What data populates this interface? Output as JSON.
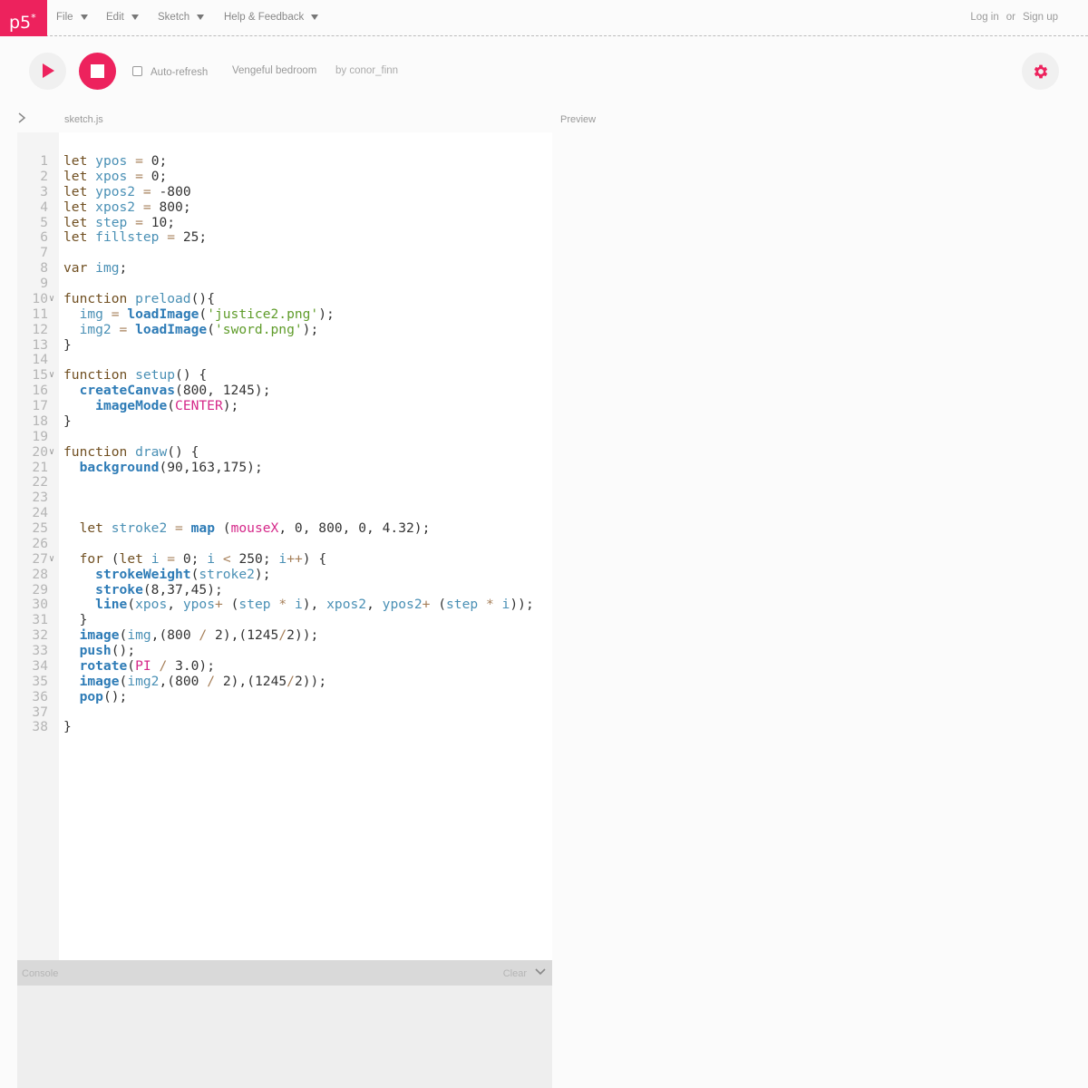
{
  "nav": {
    "logo": "p5",
    "logo_sup": "*",
    "menus": [
      {
        "label": "File"
      },
      {
        "label": "Edit"
      },
      {
        "label": "Sketch"
      },
      {
        "label": "Help & Feedback"
      }
    ],
    "login": "Log in",
    "or": "or",
    "signup": "Sign up"
  },
  "toolbar": {
    "play_icon": "play-icon",
    "stop_icon": "stop-icon",
    "auto_refresh_label": "Auto-refresh",
    "auto_refresh_checked": false,
    "sketch_name": "Vengeful bedroom",
    "author": "by conor_finn",
    "settings_icon": "gear-icon"
  },
  "editor": {
    "filename": "sketch.js",
    "lines": [
      "let ypos = 0;",
      "let xpos = 0;",
      "let ypos2 = -800",
      "let xpos2 = 800;",
      "let step = 10;",
      "let fillstep = 25;",
      "",
      "var img;",
      "",
      "function preload(){",
      "  img = loadImage('justice2.png');",
      "  img2 = loadImage('sword.png');",
      "}",
      "",
      "function setup() {",
      "  createCanvas(800, 1245);",
      "    imageMode(CENTER);",
      "}",
      "",
      "function draw() {",
      "  background(90,163,175);",
      "",
      "",
      "",
      "  let stroke2 = map (mouseX, 0, 800, 0, 4.32);",
      "",
      "  for (let i = 0; i < 250; i++) {",
      "    strokeWeight(stroke2);",
      "    stroke(8,37,45);",
      "    line(xpos, ypos+ (step * i), xpos2, ypos2+ (step * i));",
      "  }",
      "  image(img,(800 / 2),(1245/2));",
      "  push();",
      "  rotate(PI / 3.0);",
      "  image(img2,(800 / 2),(1245/2));",
      "  pop();",
      "",
      "}"
    ],
    "fold_lines": [
      10,
      15,
      20,
      27
    ]
  },
  "preview": {
    "label": "Preview"
  },
  "console": {
    "label": "Console",
    "clear": "Clear"
  },
  "colors": {
    "accent": "#ed225d",
    "keyword": "#704f21",
    "variable": "#4a90b5",
    "function": "#2d7bb6",
    "string": "#5f9c2a",
    "builtin": "#d52889"
  }
}
